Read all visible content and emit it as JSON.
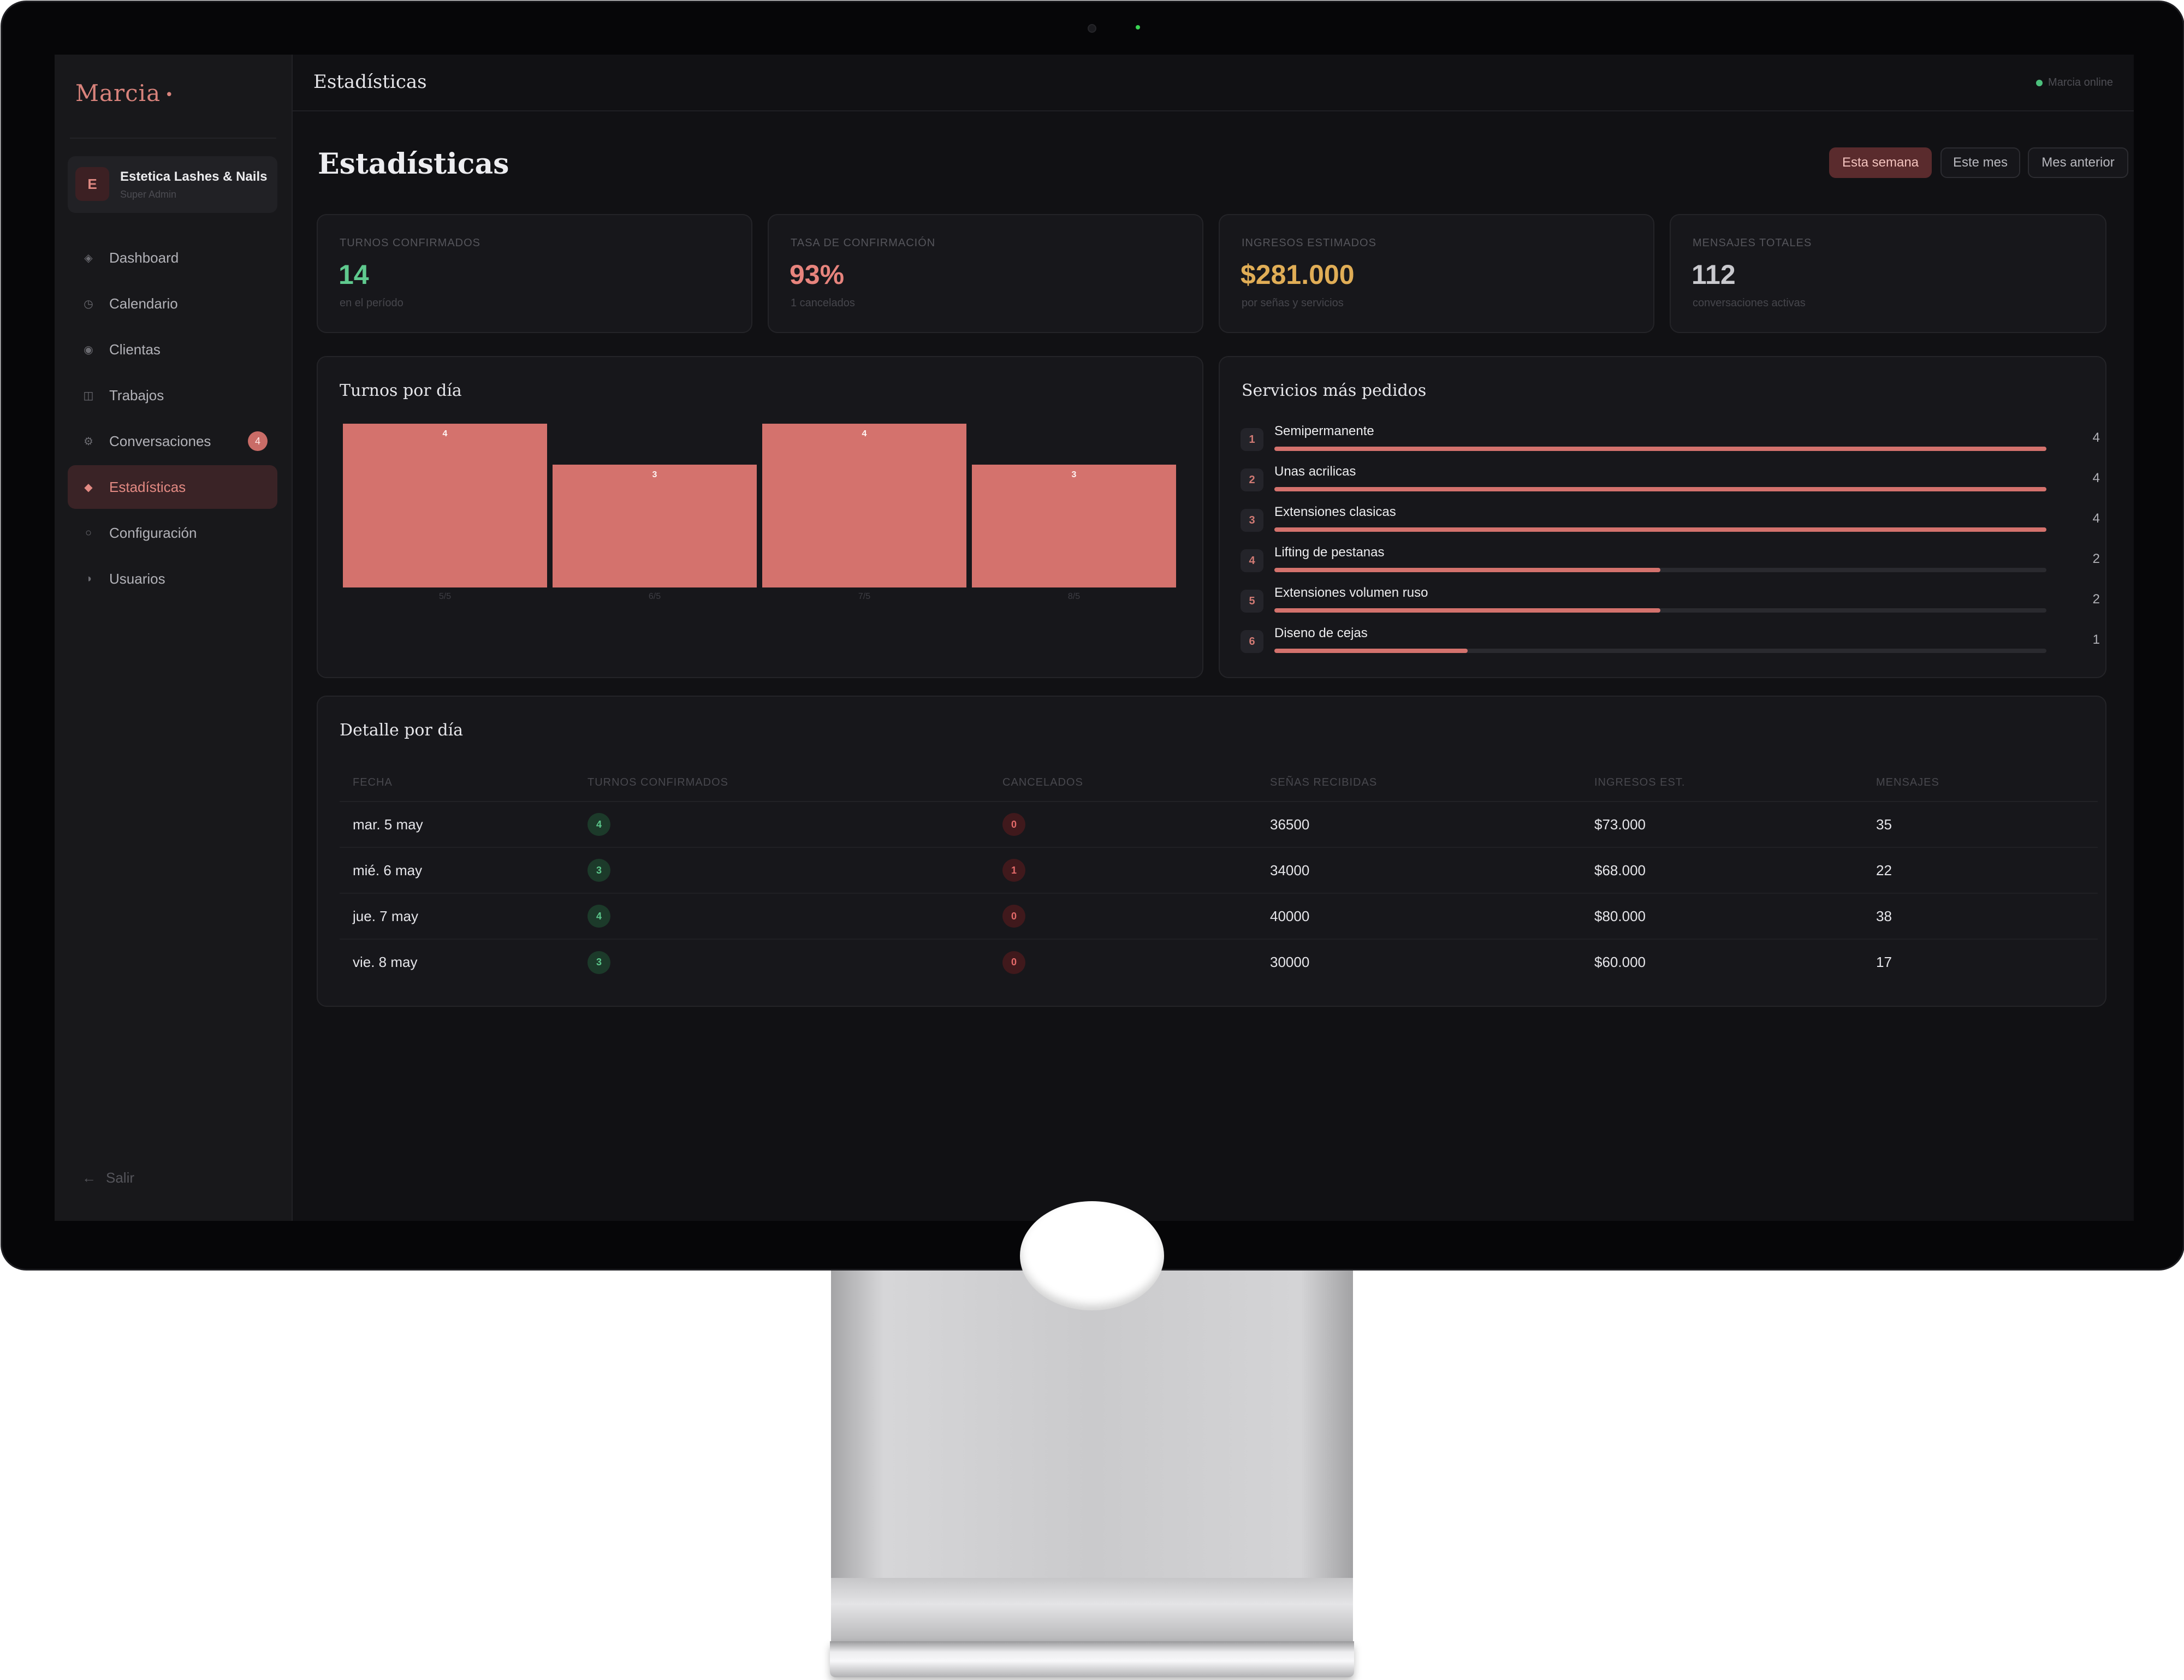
{
  "app": {
    "brand": "Marcia",
    "account": {
      "initial": "E",
      "name": "Estetica Lashes & Nails",
      "role": "Super Admin"
    },
    "nav": [
      {
        "icon": "◈",
        "label": "Dashboard"
      },
      {
        "icon": "◷",
        "label": "Calendario"
      },
      {
        "icon": "◉",
        "label": "Clientas"
      },
      {
        "icon": "◫",
        "label": "Trabajos"
      },
      {
        "icon": "⚙",
        "label": "Conversaciones",
        "badge": "4"
      },
      {
        "icon": "◆",
        "label": "Estadísticas",
        "active": true
      },
      {
        "icon": "○",
        "label": "Configuración"
      },
      {
        "icon": "◑",
        "label": "Usuarios"
      }
    ],
    "logout": {
      "icon": "←",
      "label": "Salir"
    }
  },
  "topbar": {
    "title": "Estadísticas",
    "status": "Marcia online"
  },
  "page": {
    "title": "Estadísticas",
    "ranges": [
      {
        "label": "Esta semana",
        "active": true
      },
      {
        "label": "Este mes",
        "active": false
      },
      {
        "label": "Mes anterior",
        "active": false
      }
    ]
  },
  "kpis": [
    {
      "label": "TURNOS CONFIRMADOS",
      "value": "14",
      "sub": "en el período",
      "color": "#5fc98e"
    },
    {
      "label": "TASA DE CONFIRMACIÓN",
      "value": "93%",
      "sub": "1 cancelados",
      "color": "#e7847d"
    },
    {
      "label": "INGRESOS ESTIMADOS",
      "value": "$281.000",
      "sub": "por señas y servicios",
      "color": "#e0ad56"
    },
    {
      "label": "MENSAJES TOTALES",
      "value": "112",
      "sub": "conversaciones activas",
      "color": "#c9c9ce"
    }
  ],
  "chart_data": {
    "type": "bar",
    "title": "Turnos por día",
    "categories": [
      "5/5",
      "6/5",
      "7/5",
      "8/5"
    ],
    "values": [
      4,
      3,
      4,
      3
    ],
    "ylim": [
      0,
      4
    ],
    "color": "#d4726d"
  },
  "services": {
    "title": "Servicios más pedidos",
    "items": [
      {
        "rank": "1",
        "name": "Semipermanente",
        "count": 4
      },
      {
        "rank": "2",
        "name": "Unas acrilicas",
        "count": 4
      },
      {
        "rank": "3",
        "name": "Extensiones clasicas",
        "count": 4
      },
      {
        "rank": "4",
        "name": "Lifting de pestanas",
        "count": 2
      },
      {
        "rank": "5",
        "name": "Extensiones volumen ruso",
        "count": 2
      },
      {
        "rank": "6",
        "name": "Diseno de cejas",
        "count": 1
      }
    ],
    "max": 4
  },
  "detail": {
    "title": "Detalle por día",
    "columns": [
      "FECHA",
      "TURNOS CONFIRMADOS",
      "CANCELADOS",
      "SEÑAS RECIBIDAS",
      "INGRESOS EST.",
      "MENSAJES"
    ],
    "rows": [
      {
        "fecha": "mar. 5 may",
        "turnos": "4",
        "cancelados": "0",
        "senas": "36500",
        "ingresos": "$73.000",
        "mensajes": "35"
      },
      {
        "fecha": "mié. 6 may",
        "turnos": "3",
        "cancelados": "1",
        "senas": "34000",
        "ingresos": "$68.000",
        "mensajes": "22"
      },
      {
        "fecha": "jue. 7 may",
        "turnos": "4",
        "cancelados": "0",
        "senas": "40000",
        "ingresos": "$80.000",
        "mensajes": "38"
      },
      {
        "fecha": "vie. 8 may",
        "turnos": "3",
        "cancelados": "0",
        "senas": "30000",
        "ingresos": "$60.000",
        "mensajes": "17"
      }
    ]
  }
}
